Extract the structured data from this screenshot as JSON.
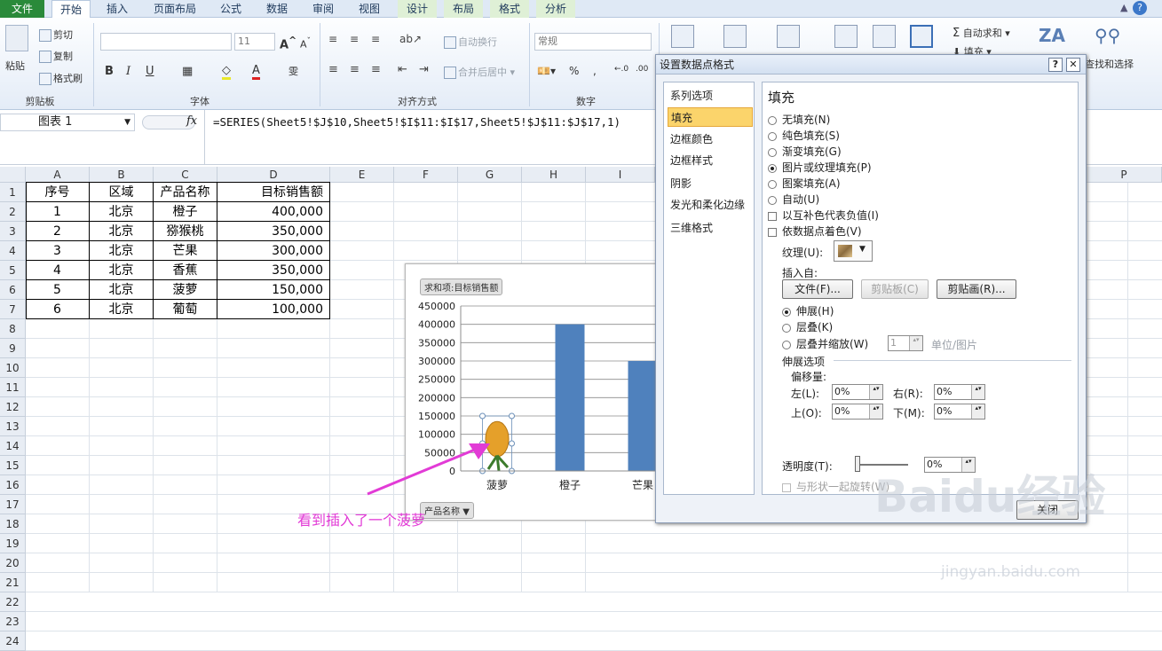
{
  "tabs": [
    "文件",
    "开始",
    "插入",
    "页面布局",
    "公式",
    "数据",
    "审阅",
    "视图",
    "设计",
    "布局",
    "格式",
    "分析"
  ],
  "ribbon": {
    "clipboard": {
      "paste": "粘贴",
      "cut": "剪切",
      "copy": "复制",
      "format_painter": "格式刷",
      "label": "剪贴板"
    },
    "font": {
      "size": "11",
      "label": "字体"
    },
    "align": {
      "wrap": "自动换行",
      "merge": "合并后居中",
      "label": "对齐方式"
    },
    "number": {
      "format": "常规",
      "label": "数字"
    },
    "editing": {
      "autosum": "自动求和",
      "fill": "填充",
      "find": "查找和选择"
    }
  },
  "formula_bar": {
    "name_box": "图表 1",
    "fx": "fx",
    "formula": "=SERIES(Sheet5!$J$10,Sheet5!$I$11:$I$17,Sheet5!$J$11:$J$17,1)"
  },
  "columns": [
    "A",
    "B",
    "C",
    "D",
    "E",
    "F",
    "G",
    "H",
    "I",
    "P"
  ],
  "rows": [
    "1",
    "2",
    "3",
    "4",
    "5",
    "6",
    "7",
    "8",
    "9",
    "10",
    "11",
    "12",
    "13",
    "14",
    "15",
    "16",
    "17",
    "18",
    "19",
    "20",
    "21",
    "22",
    "23",
    "24"
  ],
  "table": {
    "headers": [
      "序号",
      "区域",
      "产品名称",
      "目标销售额"
    ],
    "rows": [
      [
        "1",
        "北京",
        "橙子",
        "400,000"
      ],
      [
        "2",
        "北京",
        "猕猴桃",
        "350,000"
      ],
      [
        "3",
        "北京",
        "芒果",
        "300,000"
      ],
      [
        "4",
        "北京",
        "香蕉",
        "350,000"
      ],
      [
        "5",
        "北京",
        "菠萝",
        "150,000"
      ],
      [
        "6",
        "北京",
        "葡萄",
        "100,000"
      ]
    ]
  },
  "chart": {
    "field_value": "求和项:目标销售额",
    "field_axis": "产品名称",
    "bar_color": "#4f81bd"
  },
  "chart_data": {
    "type": "bar",
    "categories": [
      "菠萝",
      "橙子",
      "芒果"
    ],
    "values": [
      150000,
      400000,
      300000
    ],
    "ylim": [
      0,
      450000
    ],
    "yticks": [
      "450000",
      "400000",
      "350000",
      "300000",
      "250000",
      "200000",
      "150000",
      "100000",
      "50000",
      "0"
    ],
    "grid": true
  },
  "dialog": {
    "title": "设置数据点格式",
    "help": "?",
    "close": "✕",
    "nav": [
      "系列选项",
      "填充",
      "边框颜色",
      "边框样式",
      "阴影",
      "发光和柔化边缘",
      "三维格式"
    ],
    "pane_title": "填充",
    "fill_options": [
      "无填充(N)",
      "纯色填充(S)",
      "渐变填充(G)",
      "图片或纹理填充(P)",
      "图案填充(A)",
      "自动(U)"
    ],
    "checks": [
      "以互补色代表负值(I)",
      "依数据点着色(V)"
    ],
    "texture_label": "纹理(U):",
    "insert_from": "插入自:",
    "btn_file": "文件(F)...",
    "btn_clipboard": "剪贴板(C)",
    "btn_clipart": "剪贴画(R)...",
    "stretch_opts": [
      "伸展(H)",
      "层叠(K)",
      "层叠并缩放(W)"
    ],
    "unit_value": "1",
    "unit_label": "单位/图片",
    "stretch_section": "伸展选项",
    "offset_label": "偏移量:",
    "left": "左(L):",
    "right": "右(R):",
    "top": "上(O):",
    "bottom": "下(M):",
    "offset_value": "0%",
    "transparency": "透明度(T):",
    "transparency_value": "0%",
    "rotate": "与形状一起旋转(W)",
    "close_btn": "关闭"
  },
  "annotation": "看到插入了一个菠萝",
  "watermark": "Baidu经验",
  "watermark_url": "jingyan.baidu.com"
}
